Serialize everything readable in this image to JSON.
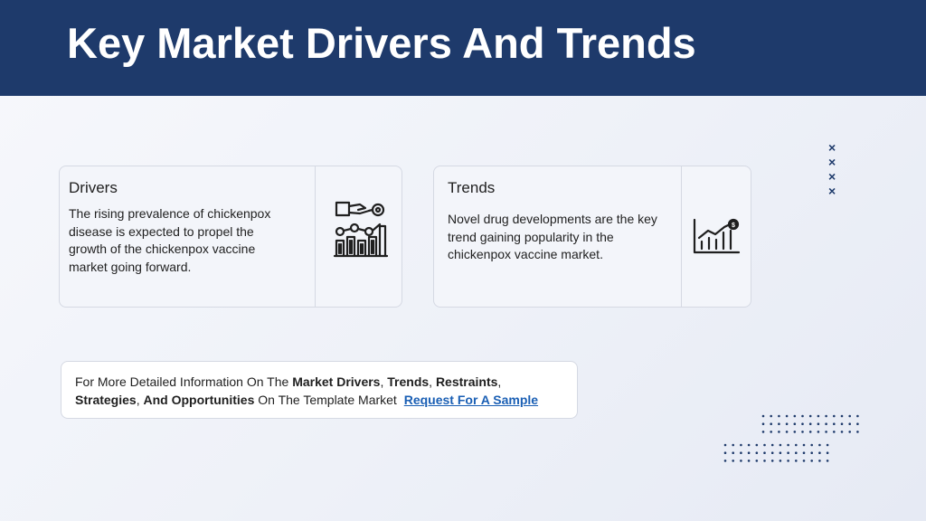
{
  "slide": {
    "title": "Key Market Drivers And Trends"
  },
  "drivers": {
    "heading": "Drivers",
    "body": "The rising prevalence of chickenpox disease is expected to propel the growth of the chickenpox vaccine market going forward.",
    "icon": "growth-drivers-icon"
  },
  "trends": {
    "heading": "Trends",
    "body": "Novel drug developments are the key trend gaining popularity in the chickenpox vaccine market.",
    "icon": "trend-chart-icon"
  },
  "info": {
    "prefix": "For More Detailed Information On The ",
    "market_drivers": "Market Drivers",
    "sep1": ", ",
    "trends": "Trends",
    "sep2": ", ",
    "restraints": "Restraints",
    "sep3": ",",
    "strategies": "Strategies",
    "sep4": ", ",
    "and": "And ",
    "opportunities": "Opportunities",
    "suffix": " On The Template Market",
    "link_label": "Request For A Sample"
  },
  "decor": {
    "x_mark": "×",
    "dot_color": "#1e3a6b"
  },
  "colors": {
    "header": "#1e3a6b",
    "link": "#1a5fb4"
  }
}
